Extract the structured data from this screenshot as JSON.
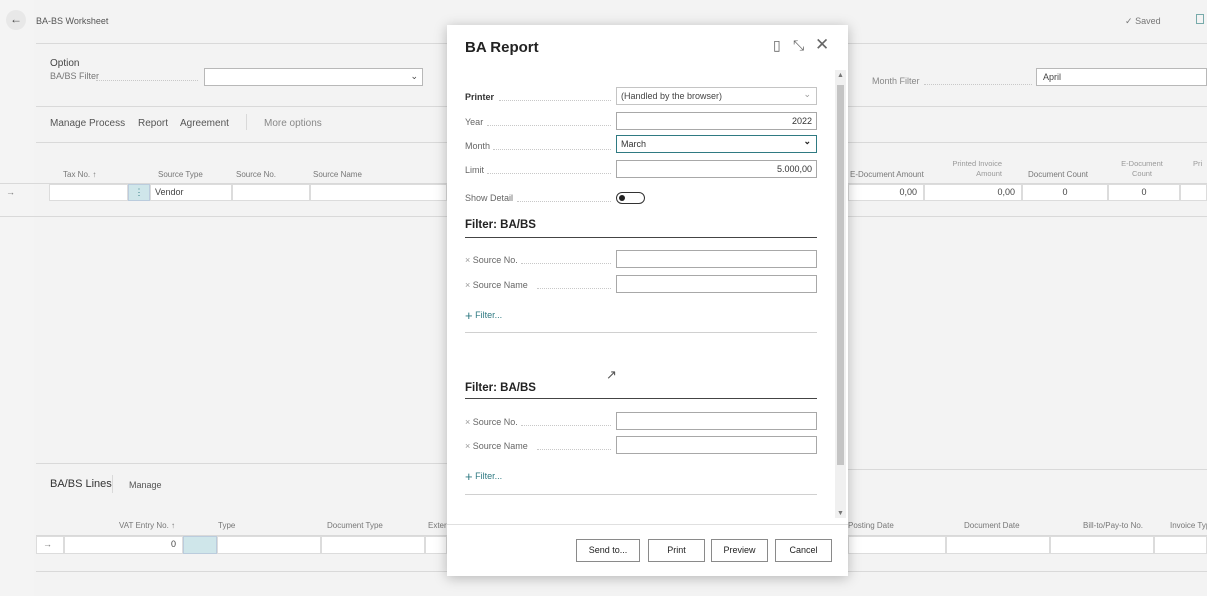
{
  "app": {
    "page_title": "BA-BS Worksheet",
    "saved_label": "Saved"
  },
  "options": {
    "section_label": "Option",
    "ba_bs_filter_label": "BA/BS Filter",
    "ba_bs_filter_value": "",
    "month_filter_label": "Month Filter",
    "month_filter_value": "April"
  },
  "actions": {
    "items": [
      "Manage",
      "Process",
      "Report",
      "Agreement"
    ],
    "more_options": "More options"
  },
  "main_grid": {
    "left_headers": [
      "Tax No. ↑",
      "Source Type",
      "Source No.",
      "Source Name"
    ],
    "right_headers": [
      "E-Document Amount",
      "Printed Invoice Amount",
      "Document Count",
      "E-Document Count",
      "Pri"
    ],
    "row": {
      "source_type": "Vendor",
      "values": [
        "0,00",
        "0,00",
        "0",
        "0"
      ]
    }
  },
  "lines": {
    "title": "BA/BS Lines",
    "manage": "Manage",
    "left_headers": [
      "VAT Entry No. ↑",
      "Type",
      "Document Type",
      "Exter"
    ],
    "right_headers": [
      "Posting Date",
      "Document Date",
      "Bill-to/Pay-to No.",
      "Invoice Type"
    ],
    "row_value": "0"
  },
  "dialog": {
    "title": "BA Report",
    "printer_label": "Printer",
    "printer_value": "(Handled by the browser)",
    "year_label": "Year",
    "year_value": "2022",
    "month_label": "Month",
    "month_value": "March",
    "limit_label": "Limit",
    "limit_value": "5.000,00",
    "show_detail_label": "Show Detail",
    "show_detail_on": false,
    "filters": [
      {
        "title": "Filter: BA/BS",
        "fields": [
          "Source No.",
          "Source Name"
        ],
        "add_filter": "Filter..."
      },
      {
        "title": "Filter: BA/BS",
        "fields": [
          "Source No.",
          "Source Name"
        ],
        "add_filter": "Filter..."
      }
    ],
    "buttons": {
      "send_to": "Send to...",
      "print": "Print",
      "preview": "Preview",
      "cancel": "Cancel"
    }
  },
  "icons": {
    "back": "back-arrow-icon",
    "saved": "checkmark-icon",
    "bookmark": "bookmark-icon",
    "expand": "expand-icon",
    "close": "close-icon",
    "dropdown": "chevron-down-icon",
    "add": "plus-icon",
    "remove": "x-icon",
    "cursor": "mouse-pointer-icon"
  },
  "colors": {
    "accent": "#2f7a82",
    "selected_cell": "#cfe6ea"
  }
}
